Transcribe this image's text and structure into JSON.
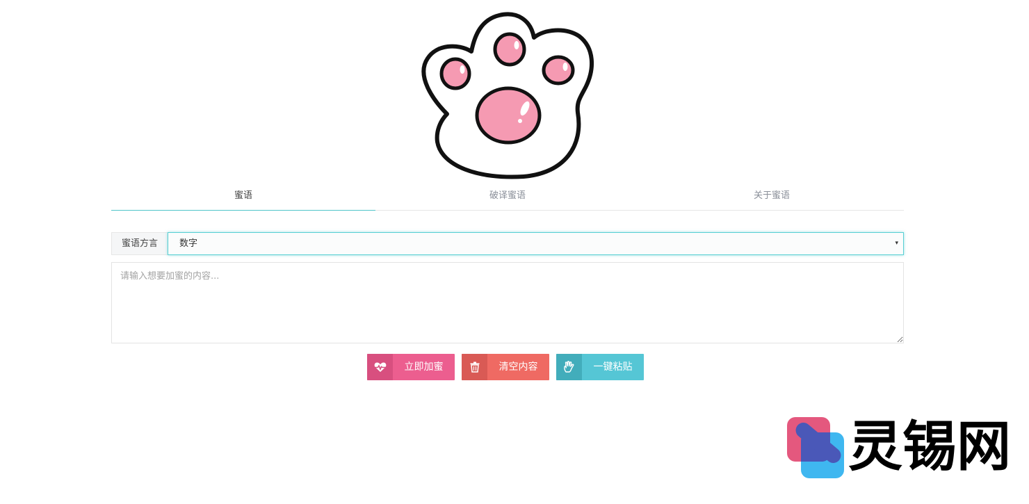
{
  "logo": {
    "icon": "cat-paw-icon",
    "colors": {
      "outline": "#111111",
      "fill": "#ffffff",
      "pad": "#f59ab2"
    }
  },
  "tabs": [
    {
      "label": "蜜语",
      "active": true
    },
    {
      "label": "破译蜜语",
      "active": false
    },
    {
      "label": "关于蜜语",
      "active": false
    }
  ],
  "dialect": {
    "label": "蜜语方言",
    "selected": "数字",
    "arrow": "▾"
  },
  "input": {
    "value": "",
    "placeholder": "请输入想要加蜜的内容..."
  },
  "buttons": {
    "encrypt": {
      "label": "立即加蜜",
      "icon": "heartbeat-icon"
    },
    "clear": {
      "label": "清空内容",
      "icon": "trash-icon"
    },
    "paste": {
      "label": "一键粘贴",
      "icon": "hand-icon"
    }
  },
  "watermark": {
    "text": "灵锡网",
    "icon": "brand-logo-icon"
  },
  "colors": {
    "accent": "#4fc4c9",
    "encrypt": "#ec5e8f",
    "clear": "#ef6a63",
    "paste": "#55c6d5"
  }
}
